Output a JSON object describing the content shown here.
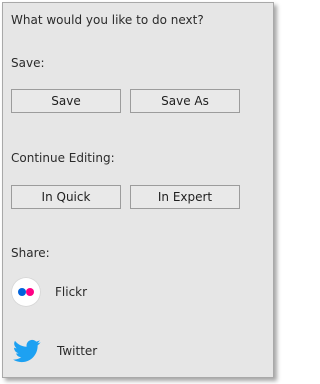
{
  "prompt": "What would you like to do next?",
  "save": {
    "label": "Save:",
    "buttons": [
      "Save",
      "Save As"
    ]
  },
  "continue_editing": {
    "label": "Continue Editing:",
    "buttons": [
      "In Quick",
      "In Expert"
    ]
  },
  "share": {
    "label": "Share:",
    "items": [
      {
        "label": "Flickr",
        "icon": "flickr-icon"
      },
      {
        "label": "Twitter",
        "icon": "twitter-icon"
      }
    ]
  },
  "colors": {
    "panel_bg": "#e6e6e6",
    "flickr_blue": "#0063dc",
    "flickr_pink": "#ff0084",
    "twitter_blue": "#1da1f2"
  }
}
